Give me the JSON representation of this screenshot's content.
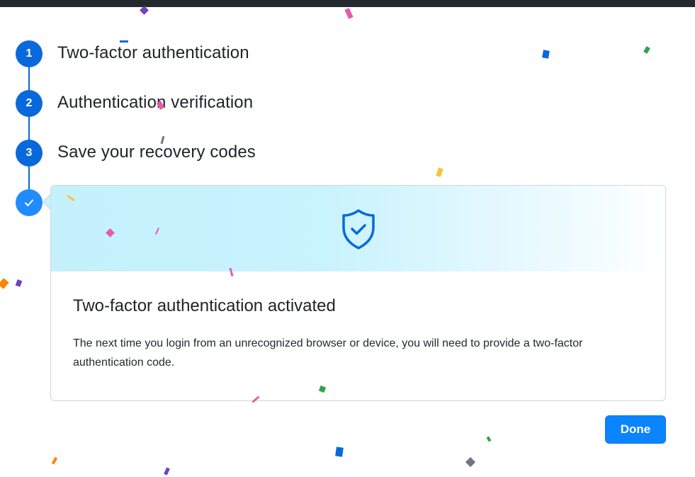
{
  "steps": [
    {
      "number": "1",
      "title": "Two-factor authentication"
    },
    {
      "number": "2",
      "title": "Authentication verification"
    },
    {
      "number": "3",
      "title": "Save your recovery codes"
    }
  ],
  "final_step": {
    "icon": "check-icon"
  },
  "card": {
    "icon": "shield-check-icon",
    "heading": "Two-factor authentication activated",
    "body": "The next time you login from an unrecognized browser or device, you will need to provide a two-factor authentication code."
  },
  "actions": {
    "done_label": "Done"
  },
  "colors": {
    "accent": "#0969da",
    "button": "#0a84ff",
    "banner": "#c4f1fc",
    "topbar": "#24292f"
  }
}
